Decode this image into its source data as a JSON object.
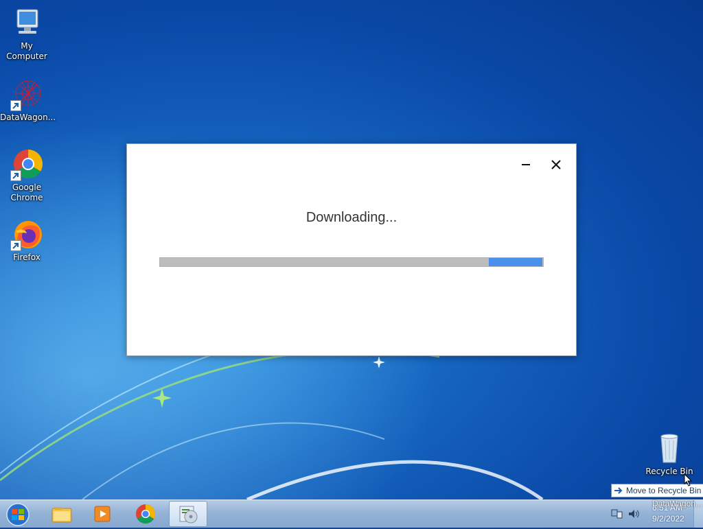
{
  "desktop": {
    "icons": [
      {
        "label": "My Computer"
      },
      {
        "label": "DataWagon..."
      },
      {
        "label": "Google Chrome"
      },
      {
        "label": "Firefox"
      },
      {
        "label": "Recycle Bin"
      }
    ]
  },
  "dialog": {
    "status_text": "Downloading...",
    "progress_fraction": 0.14,
    "progress_color": "#4a90ea"
  },
  "taskbar": {
    "items": [
      {
        "icon": "start-orb-icon"
      },
      {
        "icon": "file-explorer-icon"
      },
      {
        "icon": "media-player-icon"
      },
      {
        "icon": "chrome-icon"
      },
      {
        "icon": "installer-icon",
        "active": true
      }
    ],
    "clock": {
      "time": "6:51 AM",
      "date": "9/2/2022"
    }
  },
  "drag": {
    "tooltip": "Move to Recycle Bin",
    "drag_label": "DataWagon..."
  }
}
